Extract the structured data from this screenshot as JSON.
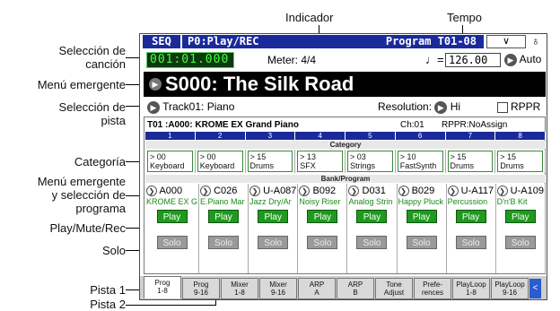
{
  "annotations": {
    "indicador": "Indicador",
    "tempo": "Tempo",
    "seleccion_cancion_1": "Selección de",
    "seleccion_cancion_2": "canción",
    "menu_emergente": "Menú emergente",
    "seleccion_pista_1": "Selección de",
    "seleccion_pista_2": "pista",
    "categoria": "Categoría",
    "menu_prog_1": "Menú emergente",
    "menu_prog_2": "y selección de",
    "menu_prog_3": "programa",
    "play_mute_rec": "Play/Mute/Rec",
    "solo": "Solo",
    "pista1": "Pista 1",
    "pista2": "Pista 2"
  },
  "title_bar": {
    "mode": "SEQ",
    "page": "P0:Play/REC",
    "tab_label": "Program T01-08",
    "menu_glyph": "∨",
    "metronome_glyph": "♁"
  },
  "locator": "001:01.000",
  "meter": "Meter:  4/4",
  "tempo": {
    "note": "♩=",
    "value": "126.00",
    "mode": "Auto"
  },
  "song": "S000: The Silk Road",
  "track_select": "Track01: Piano",
  "resolution": {
    "label": "Resolution:",
    "value": "Hi"
  },
  "rppr_label": "RPPR",
  "track_info": {
    "track": "T01 :A000: KROME EX Grand Piano",
    "channel": "Ch:01",
    "rppr": "RPPR:NoAssign"
  },
  "section_category": "Category",
  "section_bank": "Bank/Program",
  "tracks": [
    {
      "num": "1",
      "cat_num": "> 00",
      "category": "Keyboard",
      "program": "A000",
      "prog_name": "KROME EX G",
      "play": "Play",
      "solo": "Solo"
    },
    {
      "num": "2",
      "cat_num": "> 00",
      "category": "Keyboard",
      "program": "C026",
      "prog_name": "E.Piano Mar",
      "play": "Play",
      "solo": "Solo"
    },
    {
      "num": "3",
      "cat_num": "> 15",
      "category": "Drums",
      "program": "U-A087",
      "prog_name": "Jazz Dry/Ar",
      "play": "Play",
      "solo": "Solo"
    },
    {
      "num": "4",
      "cat_num": "> 13",
      "category": "SFX",
      "program": "B092",
      "prog_name": "Noisy Riser",
      "play": "Play",
      "solo": "Solo"
    },
    {
      "num": "5",
      "cat_num": "> 03",
      "category": "Strings",
      "program": "D031",
      "prog_name": "Analog Strin",
      "play": "Play",
      "solo": "Solo"
    },
    {
      "num": "6",
      "cat_num": "> 10",
      "category": "FastSynth",
      "program": "B029",
      "prog_name": "Happy Pluck",
      "play": "Play",
      "solo": "Solo"
    },
    {
      "num": "7",
      "cat_num": "> 15",
      "category": "Drums",
      "program": "U-A117",
      "prog_name": "Percussion",
      "play": "Play",
      "solo": "Solo"
    },
    {
      "num": "8",
      "cat_num": "> 15",
      "category": "Drums",
      "program": "U-A109",
      "prog_name": "D'n'B Kit",
      "play": "Play",
      "solo": "Solo"
    }
  ],
  "tabs": [
    {
      "l1": "Prog",
      "l2": "1-8"
    },
    {
      "l1": "Prog",
      "l2": "9-16"
    },
    {
      "l1": "Mixer",
      "l2": "1-8"
    },
    {
      "l1": "Mixer",
      "l2": "9-16"
    },
    {
      "l1": "ARP",
      "l2": "A"
    },
    {
      "l1": "ARP",
      "l2": "B"
    },
    {
      "l1": "Tone",
      "l2": "Adjust"
    },
    {
      "l1": "Prefe-",
      "l2": "rences"
    },
    {
      "l1": "PlayLoop",
      "l2": "1-8"
    },
    {
      "l1": "PlayLoop",
      "l2": "9-16"
    }
  ],
  "tab_arrow": "<"
}
